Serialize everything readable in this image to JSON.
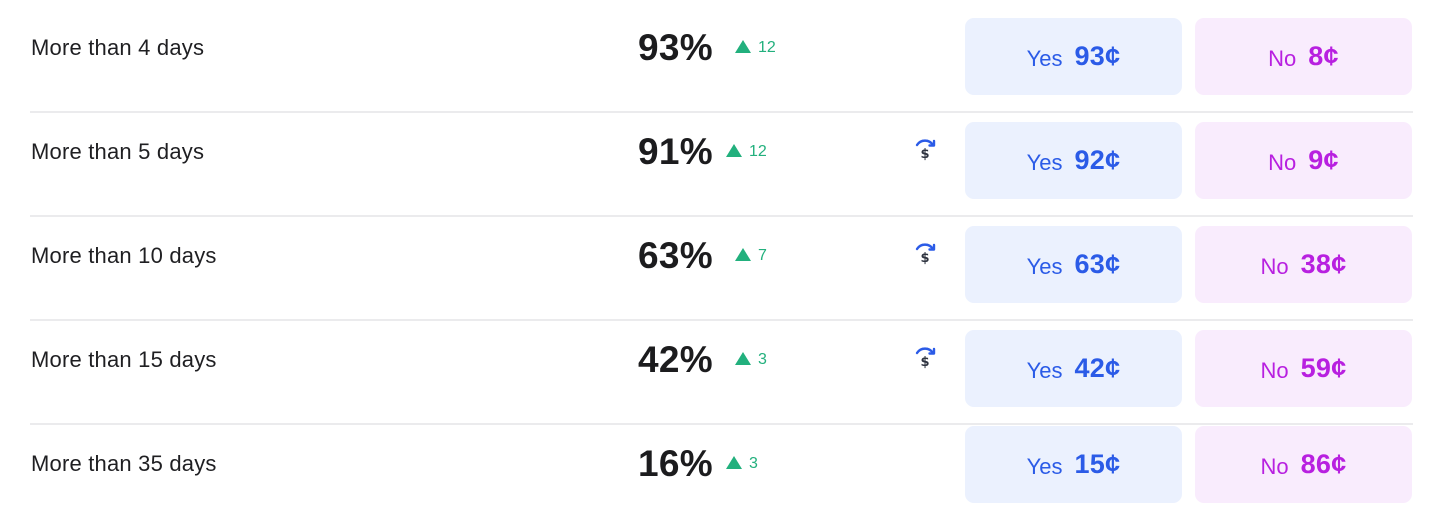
{
  "colors": {
    "up": "#22b07d",
    "yes_text": "#2b5be7",
    "yes_bg": "#ebf1fe",
    "no_text": "#b820e0",
    "no_bg": "#f9ecfd",
    "rebate_icon": "#2b5be7"
  },
  "rows": [
    {
      "label": "More than 4 days",
      "percent": "93%",
      "change": "12",
      "change_direction": "up",
      "rebate_icon": false,
      "yes_label": "Yes",
      "yes_price": "93¢",
      "no_label": "No",
      "no_price": "8¢"
    },
    {
      "label": "More than 5 days",
      "percent": "91%",
      "change": "12",
      "change_direction": "up",
      "rebate_icon": true,
      "icon": "dollar-refresh-icon",
      "yes_label": "Yes",
      "yes_price": "92¢",
      "no_label": "No",
      "no_price": "9¢"
    },
    {
      "label": "More than 10 days",
      "percent": "63%",
      "change": "7",
      "change_direction": "up",
      "rebate_icon": true,
      "icon": "dollar-refresh-icon",
      "yes_label": "Yes",
      "yes_price": "63¢",
      "no_label": "No",
      "no_price": "38¢"
    },
    {
      "label": "More than 15 days",
      "percent": "42%",
      "change": "3",
      "change_direction": "up",
      "rebate_icon": true,
      "icon": "dollar-refresh-icon",
      "yes_label": "Yes",
      "yes_price": "42¢",
      "no_label": "No",
      "no_price": "59¢"
    },
    {
      "label": "More than 35 days",
      "percent": "16%",
      "change": "3",
      "change_direction": "up",
      "rebate_icon": false,
      "yes_label": "Yes",
      "yes_price": "15¢",
      "no_label": "No",
      "no_price": "86¢"
    }
  ]
}
